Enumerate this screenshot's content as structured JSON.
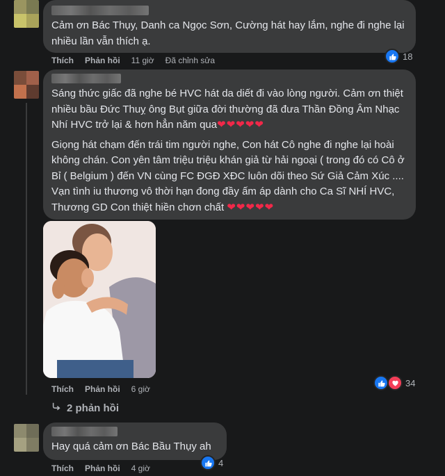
{
  "comments": [
    {
      "text": "Cảm ơn Bác Thụy, Danh ca Ngọc Sơn, Cường hát hay lắm, nghe đi nghe lại nhiều lần vẫn thích ạ.",
      "like_label": "Thích",
      "reply_label": "Phản hồi",
      "time": "11 giờ",
      "edited": "Đã chỉnh sửa",
      "reaction_count": "18"
    },
    {
      "para1": "Sáng thức giấc đã nghe bé HVC hát da diết đi vào lòng người. Cảm ơn thiệt nhiều bầu Đức Thuỵ ông Bụt giữa đời thường đã đưa Thần Đồng Âm Nhạc Nhí HVC trở lại & hơn hẳn năm qua",
      "para1_hearts": "❤❤❤❤❤",
      "para2": "Giọng hát chạm đến trái tim người nghe, Con hát Cô nghe đi nghe lại hoài không chán. Con yên tâm triệu triệu khán giả từ hải ngoại ( trong đó có Cô ở Bỉ ( Belgium ) đến VN cùng FC ĐGĐ XĐC luôn dõi theo Sứ Giả Cảm Xúc .... Vạn tình iu thương vô thời hạn đong đầy ấm áp dành cho Ca Sĩ NHÍ HVC, Thương GD Con thiệt hiền chơn chất",
      "para2_hearts": "❤❤❤❤❤",
      "like_label": "Thích",
      "reply_label": "Phản hồi",
      "time": "6 giờ",
      "reaction_count": "34",
      "replies_label": "2 phản hồi"
    },
    {
      "text": "Hay quá cảm ơn Bác Bầu Thụy ah",
      "like_label": "Thích",
      "reply_label": "Phản hồi",
      "time": "4 giờ",
      "reaction_count": "4"
    }
  ],
  "colors": {
    "background": "#18191a",
    "bubble": "#3a3b3c",
    "like_blue": "#1877f2",
    "love_red": "#f33e58"
  }
}
